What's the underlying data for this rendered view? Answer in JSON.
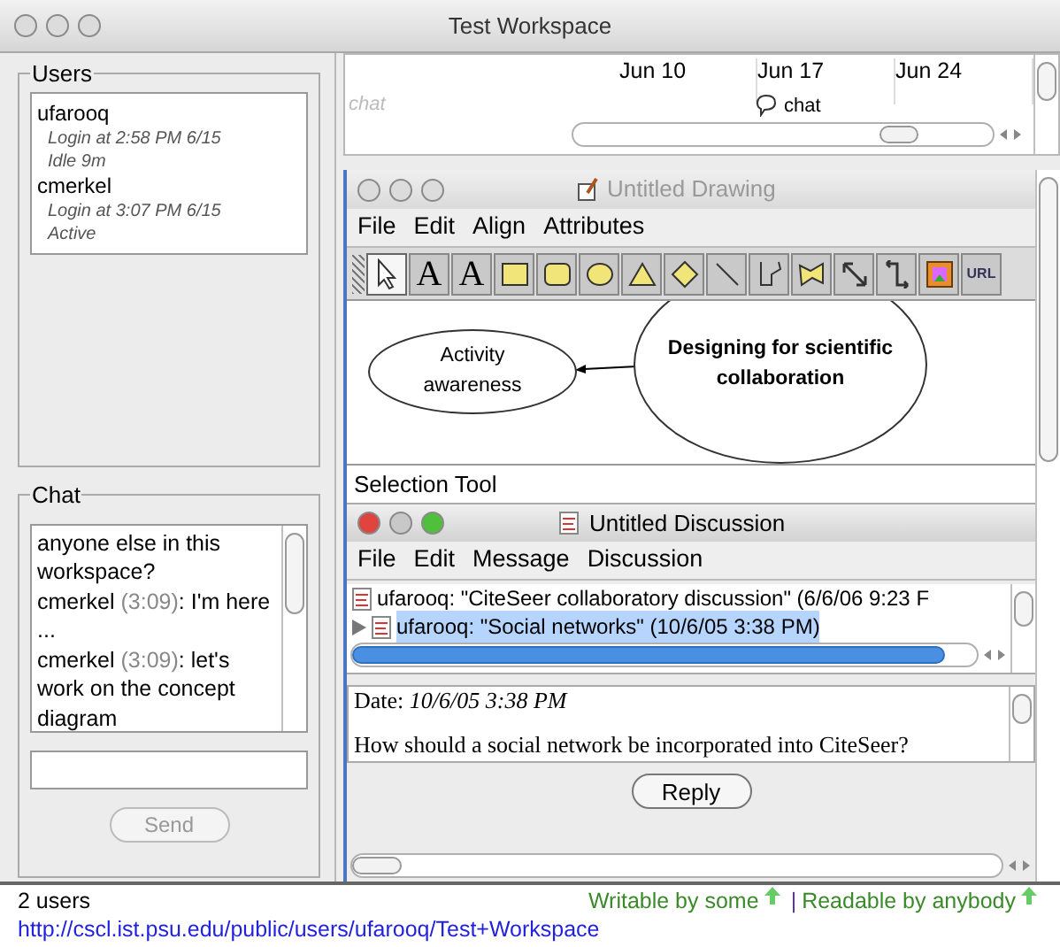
{
  "window": {
    "title": "Test Workspace"
  },
  "users_panel": {
    "title": "Users",
    "users": [
      {
        "name": "ufarooq",
        "login": "Login at 2:58 PM 6/15",
        "status": "Idle 9m"
      },
      {
        "name": "cmerkel",
        "login": "Login at 3:07 PM 6/15",
        "status": "Active"
      }
    ]
  },
  "chat_panel": {
    "title": "Chat",
    "messages": [
      {
        "text": "anyone else in this workspace?"
      },
      {
        "user": "cmerkel",
        "time": "(3:09)",
        "text": ": I'm here ..."
      },
      {
        "user": "cmerkel",
        "time": "(3:09)",
        "text": ": let's work on the concept diagram"
      }
    ],
    "send_button": {
      "label": "Send",
      "disabled": true
    }
  },
  "timeline": {
    "track_label": "chat",
    "dates": [
      "Jun 10",
      "Jun 17",
      "Jun 24"
    ],
    "event": "chat"
  },
  "drawing_window": {
    "title": "Untitled Drawing",
    "active": false,
    "menu": [
      "File",
      "Edit",
      "Align",
      "Attributes"
    ],
    "tools": [
      {
        "kind": "select",
        "selected": true
      },
      {
        "kind": "text",
        "label": "A",
        "selected": false
      },
      {
        "kind": "text-link",
        "label": "A",
        "selected": false
      },
      {
        "kind": "rect",
        "selected": false
      },
      {
        "kind": "round-rect",
        "selected": false
      },
      {
        "kind": "ellipse",
        "selected": false
      },
      {
        "kind": "triangle",
        "selected": false
      },
      {
        "kind": "diamond",
        "selected": false
      },
      {
        "kind": "line",
        "selected": false
      },
      {
        "kind": "polyline",
        "selected": false
      },
      {
        "kind": "polygon",
        "selected": false
      },
      {
        "kind": "connector",
        "selected": false
      },
      {
        "kind": "elbow",
        "selected": false
      },
      {
        "kind": "image",
        "selected": false
      },
      {
        "kind": "url",
        "label": "URL",
        "selected": false
      }
    ],
    "nodes": [
      {
        "text": "Activity awareness",
        "bold": false
      },
      {
        "text": "Designing for scientific collaboration",
        "bold": true
      }
    ],
    "status": "Selection Tool"
  },
  "discussion_window": {
    "title": "Untitled Discussion",
    "active": true,
    "menu": [
      "File",
      "Edit",
      "Message",
      "Discussion"
    ],
    "threads": [
      {
        "text": "ufarooq: \"CiteSeer collaboratory discussion\" (6/6/06 9:23 F",
        "expandable": false,
        "selected": false
      },
      {
        "text": "ufarooq: \"Social networks\" (10/6/05 3:38 PM)",
        "expandable": true,
        "selected": true
      }
    ],
    "date_label": "Date:",
    "date": "10/6/05 3:38 PM",
    "body": "How should a social network be incorporated into CiteSeer?",
    "reply_button": "Reply"
  },
  "status_bar": {
    "users": "2 users",
    "write": "Writable by some",
    "separator": "|",
    "read": "Readable by anybody",
    "url": "http://cscl.ist.psu.edu/public/users/ufarooq/Test+Workspace"
  }
}
